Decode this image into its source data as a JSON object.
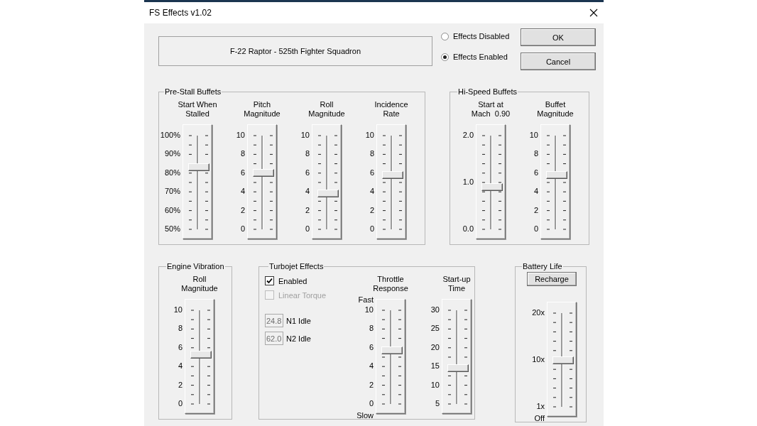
{
  "window": {
    "title": "FS Effects v1.02"
  },
  "aircraft_name": "F-22 Raptor - 525th Fighter Squadron",
  "mode_options": [
    {
      "label": "Effects Disabled",
      "selected": false
    },
    {
      "label": "Effects Enabled",
      "selected": true
    }
  ],
  "buttons": [
    "OK",
    "Cancel"
  ],
  "pre_stall_buffets": {
    "title": "Pre-Stall Buffets",
    "sliders": [
      {
        "caption": "Start When\nStalled",
        "labels": [
          "100%",
          "90%",
          "80%",
          "70%",
          "60%",
          "50%"
        ],
        "level": 0.66
      },
      {
        "caption": "Pitch\nMagnitude",
        "labels": [
          "10",
          "8",
          "6",
          "4",
          "2",
          "0"
        ],
        "level": 0.6
      },
      {
        "caption": "Roll\nMagnitude",
        "labels": [
          "10",
          "8",
          "6",
          "4",
          "2",
          "0"
        ],
        "level": 0.38
      },
      {
        "caption": "Incidence\nRate",
        "labels": [
          "10",
          "8",
          "6",
          "4",
          "2",
          "0"
        ],
        "level": 0.58
      }
    ]
  },
  "hi_speed_buffets": {
    "title": "Hi-Speed Buffets",
    "sliders": [
      {
        "caption": "Start at\nMach  0.90",
        "labels": [
          "2.0",
          "1.0",
          "0.0"
        ],
        "level": 0.45
      },
      {
        "caption": "Buffet\nMagnitude",
        "labels": [
          "10",
          "8",
          "6",
          "4",
          "2",
          "0"
        ],
        "level": 0.58
      }
    ]
  },
  "engine_vibration": {
    "title": "Engine Vibration",
    "sliders": [
      {
        "caption": "Roll\nMagnitude",
        "labels": [
          "10",
          "8",
          "6",
          "4",
          "2",
          "0"
        ],
        "level": 0.53
      }
    ]
  },
  "turbojet_effects": {
    "title": "Turbojet Effects",
    "checkboxes": [
      {
        "label": "Enabled",
        "checked": true,
        "disabled": false
      },
      {
        "label": "Linear Torque",
        "checked": false,
        "disabled": true
      }
    ],
    "fields": [
      {
        "value": "24.8",
        "label": "N1 Idle"
      },
      {
        "value": "62.0",
        "label": "N2 Idle"
      }
    ],
    "sliders": [
      {
        "caption": "Throttle\nResponse",
        "top_note": "Fast",
        "labels": [
          "10",
          "8",
          "6",
          "4",
          "2",
          "0"
        ],
        "bottom_note": "Slow",
        "level": 0.57
      },
      {
        "caption": "Start-up\nTime",
        "labels": [
          "30",
          "25",
          "20",
          "15",
          "10",
          "5"
        ],
        "level": 0.38
      }
    ]
  },
  "battery_life": {
    "title": "Battery Life",
    "button": "Recharge",
    "sliders": [
      {
        "labels": [
          "20x",
          "10x",
          "1x"
        ],
        "bottom_note": "Off",
        "level": 0.5
      }
    ]
  }
}
